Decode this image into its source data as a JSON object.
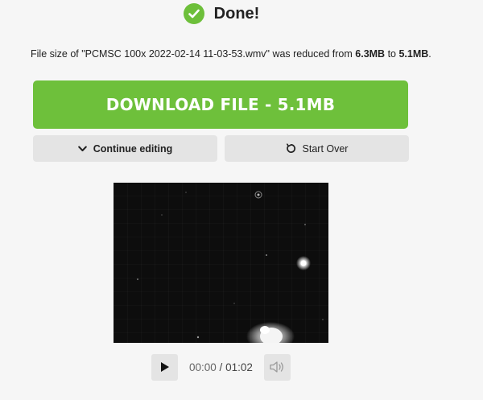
{
  "header": {
    "title": "Done!",
    "icon": "check-circle-icon",
    "accent": "#6dbf3a"
  },
  "info": {
    "prefix": "File size of \"PCMSC 100x 2022-02-14 11-03-53.wmv\" was reduced from ",
    "from_size": "6.3MB",
    "middle": " to ",
    "to_size": "5.1MB",
    "suffix": "."
  },
  "actions": {
    "download_label": "DOWNLOAD FILE - 5.1MB",
    "download_color": "#6ec03b",
    "continue_label": "Continue editing",
    "continue_icon": "chevron-down-icon",
    "start_over_label": "Start Over",
    "start_over_icon": "restart-icon"
  },
  "player": {
    "current_time": "00:00",
    "separator": " / ",
    "total_time": "01:02",
    "play_icon": "play-icon",
    "volume_icon": "volume-icon"
  }
}
